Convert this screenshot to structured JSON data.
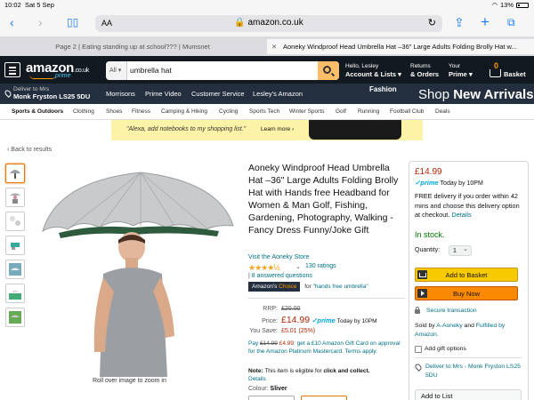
{
  "status_bar": {
    "time": "10:02",
    "date": "Sat 5 Sep",
    "battery": "13%"
  },
  "browser": {
    "text_size_label": "AA",
    "url": "amazon.co.uk",
    "tabs": [
      {
        "title": "Page 2 | Eating standing up at school??? | Mumsnet"
      },
      {
        "title": "Aoneky Windproof Head Umbrella Hat –36\" Large Adults Folding Brolly Hat w..."
      }
    ]
  },
  "header": {
    "logo": "amazon",
    "logo_suffix": ".co.uk",
    "logo_sub": "prime",
    "search_category": "All",
    "search_query": "umbrella hat",
    "account_greeting": "Hello, Lesley",
    "account_label": "Account & Lists",
    "returns_label": "Returns",
    "orders_label": "& Orders",
    "prime_top": "Your",
    "prime_label": "Prime",
    "basket_count": "0",
    "basket_label": "Basket"
  },
  "subnav": {
    "deliver_line1": "Deliver to Mrs",
    "deliver_line2": "Monk Fryston LS25 5DU",
    "items": [
      "Morrisons",
      "Prime Video",
      "Customer Service",
      "Lesley's Amazon"
    ],
    "fashion": "Fashion",
    "shop_new_prefix": "Shop",
    "shop_new_suffix": "New Arrivals"
  },
  "categories": [
    "Sports & Outdoors",
    "Clothing",
    "Shoes",
    "Fitness",
    "Camping & Hiking",
    "Cycling",
    "Sports Tech",
    "Winter Sports",
    "Golf",
    "Running",
    "Football Club",
    "Deals"
  ],
  "banner": {
    "text": "\"Alexa, add notebooks to my shopping list.\"",
    "learn_more": "Learn more ›"
  },
  "back_link": "‹ Back to results",
  "image_caption": "Roll over image to zoom in",
  "product": {
    "title": "Aoneky Windproof Head Umbrella Hat –36\" Large Adults Folding Brolly Hat with Hands free Headband for Women & Man Golf, Fishing, Gardening, Photography, Walking - Fancy Dress Funny/Joke Gift",
    "store_link": "Visit the Aoneky Store",
    "stars": "★★★★½",
    "rating": 4.5,
    "ratings_count": "130 ratings",
    "answered": "8 answered questions",
    "choice_badge_prefix": "Amazon's",
    "choice_badge_suffix": "Choice",
    "choice_for": "for",
    "choice_query": "\"hands free umbrella\"",
    "rrp_label": "RRP:",
    "rrp": "£20.00",
    "price_label": "Price:",
    "price": "£14.99",
    "prime": "✓prime",
    "price_delivery": "Today by 10PM",
    "save_label": "You Save:",
    "save": "£5.01 (25%)",
    "promo_pay": "Pay",
    "promo_old": "£14.99",
    "promo_new": "£4.99",
    "promo_rest": ": get a £10 Amazon Gift Card on approval for the Amazon Platinum Mastercard. Terms apply.",
    "note_label": "Note:",
    "note_text": "This item is eligible for",
    "note_bold": "click and collect.",
    "note_details": "Details",
    "colour_label": "Colour:",
    "colour": "Sliver"
  },
  "buybox": {
    "price": "£14.99",
    "prime": "✓prime",
    "delivery": "Today by 10PM",
    "free_delivery": "FREE delivery if you order within 42 mins and choose this delivery option at checkout.",
    "details": "Details",
    "stock": "In stock.",
    "quantity_label": "Quantity:",
    "quantity": "1",
    "add_to_basket": "Add to Basket",
    "buy_now": "Buy Now",
    "secure": "Secure transaction",
    "sold_by_prefix": "Sold by",
    "seller": "A-Aoneky",
    "fulfilled_prefix": "and",
    "fulfilled": "Fulfilled by Amazon.",
    "gift_options": "Add gift options",
    "deliver_to": "Deliver to Mrs - Monk Fryston LS25 5DU",
    "add_to_list": "Add to List"
  },
  "colors": {
    "amazon_dark": "#131921",
    "amazon_nav": "#232f3e",
    "accent_orange": "#ff9900",
    "link": "#007185",
    "price_red": "#b12704",
    "in_stock_green": "#007600",
    "safari_blue": "#1a7cf5"
  }
}
